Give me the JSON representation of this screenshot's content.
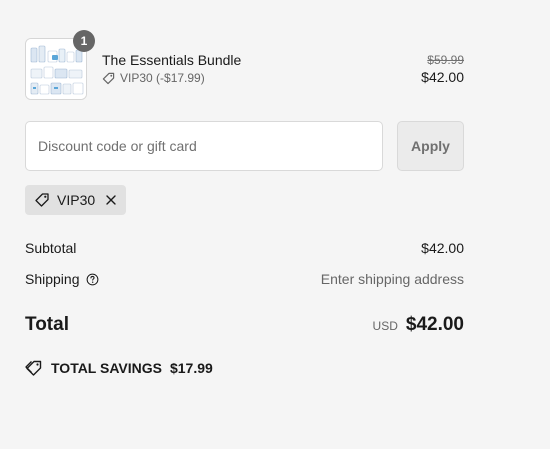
{
  "cart": {
    "item": {
      "name": "The Essentials Bundle",
      "quantity": "1",
      "discount_label": "VIP30 (-$17.99)",
      "original_price": "$59.99",
      "final_price": "$42.00",
      "thumbnail_icon": "product-bundle-image"
    }
  },
  "discount": {
    "placeholder": "Discount code or gift card",
    "value": "",
    "apply_label": "Apply",
    "applied_code": "VIP30"
  },
  "summary": {
    "subtotal_label": "Subtotal",
    "subtotal_value": "$42.00",
    "shipping_label": "Shipping",
    "shipping_value": "Enter shipping address",
    "total_label": "Total",
    "currency": "USD",
    "total_value": "$42.00",
    "savings_label": "TOTAL SAVINGS",
    "savings_value": "$17.99"
  },
  "colors": {
    "background": "#f5f5f5",
    "chip_background": "#e1e1e1",
    "apply_background": "#ebebeb",
    "badge": "#666666",
    "text": "#1a1a1a",
    "muted": "#707070"
  }
}
